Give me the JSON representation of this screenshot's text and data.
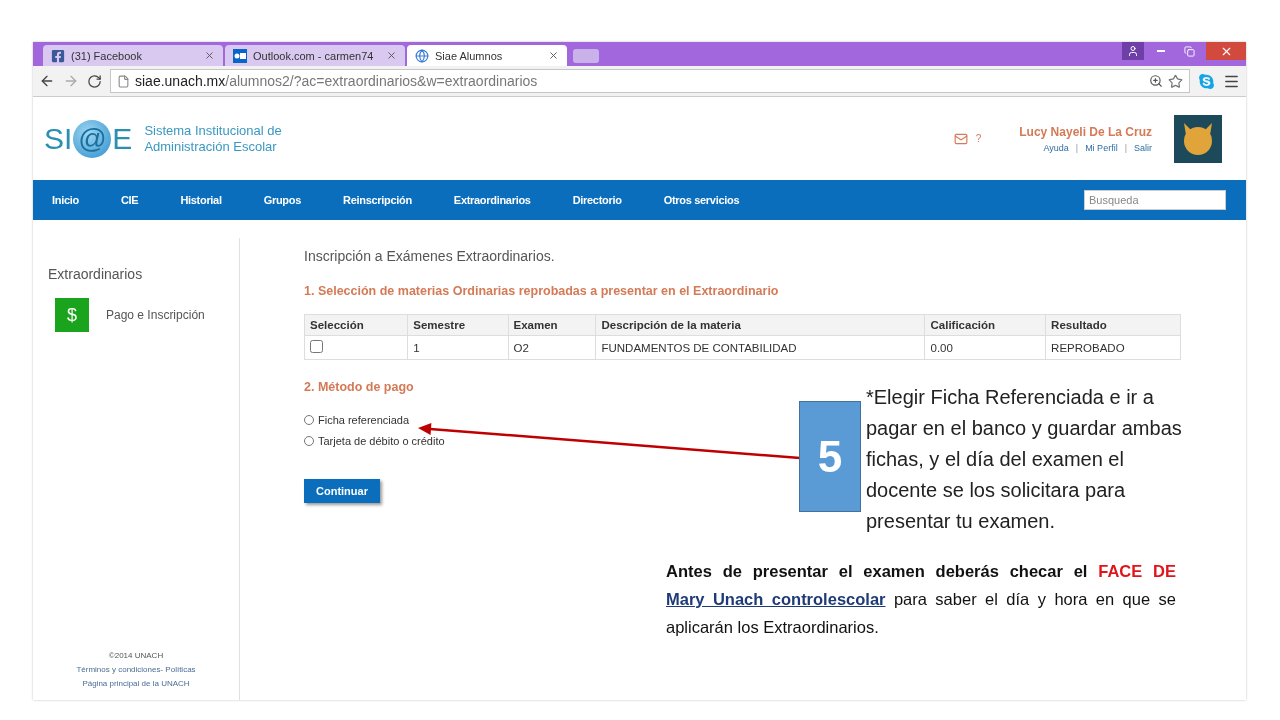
{
  "browser": {
    "tabs": [
      {
        "label": "(31) Facebook",
        "kind": "facebook",
        "selected": false
      },
      {
        "label": "Outlook.com - carmen74",
        "kind": "outlook",
        "selected": false
      },
      {
        "label": "Siae Alumnos",
        "kind": "globe",
        "selected": true
      }
    ],
    "url_host": "siae.unach.mx",
    "url_path": "/alumnos2/?ac=extraordinarios&w=extraordinarios"
  },
  "header": {
    "logo": {
      "left": "SI",
      "mark": "@",
      "right": "E"
    },
    "title_lines": [
      "Sistema Institucional de",
      "Administración Escolar"
    ],
    "help": "?",
    "user_name": "Lucy Nayeli De La Cruz",
    "user_links": [
      "Ayuda",
      "Mi Perfil",
      "Salir"
    ],
    "separator": "|"
  },
  "nav": {
    "items": [
      "Inicio",
      "CIE",
      "Historial",
      "Grupos",
      "Reinscripción",
      "Extraordinarios",
      "Directorio",
      "Otros servicios"
    ],
    "search": {
      "placeholder": "Busqueda"
    }
  },
  "sidebar": {
    "title": "Extraordinarios",
    "items": [
      {
        "icon": "$",
        "label": "Pago e Inscripción"
      }
    ]
  },
  "footer": {
    "copyright": "©2014 UNACH",
    "links": [
      "Términos y condiciones- Políticas",
      "Página principal de la UNACH"
    ]
  },
  "main": {
    "title": "Inscripción a Exámenes Extraordinarios.",
    "section_1": "1. Selección de materias Ordinarias reprobadas a presentar en el Extraordinario",
    "table": {
      "columns": [
        "Selección",
        "Semestre",
        "Examen",
        "Descripción de la materia",
        "Calificación",
        "Resultado"
      ],
      "rows": [
        {
          "cells": [
            {
              "kind": "checkbox",
              "checked": false
            },
            {
              "kind": "text",
              "text": "1"
            },
            {
              "kind": "text",
              "text": "O2"
            },
            {
              "kind": "text",
              "text": "FUNDAMENTOS DE CONTABILIDAD"
            },
            {
              "kind": "text",
              "text": "0.00"
            },
            {
              "kind": "text",
              "text": "REPROBADO"
            }
          ]
        }
      ]
    },
    "section_2": "2. Método de pago",
    "payment_options": [
      {
        "label": "Ficha referenciada",
        "selected": false
      },
      {
        "label": "Tarjeta de débito o crédito",
        "selected": false
      }
    ],
    "button": "Continuar"
  },
  "annotation": {
    "step": "5",
    "callout": "*Elegir Ficha Referenciada e ir a pagar en el banco y guardar ambas fichas, y el día del examen el docente se los solicitara para presentar tu examen.",
    "note": [
      {
        "kind": "bold",
        "text": "Antes de presentar el examen deberás checar el "
      },
      {
        "kind": "highlight",
        "text": "FACE DE "
      },
      {
        "kind": "link",
        "text": "Mary Unach controlescolar"
      },
      {
        "kind": "plain",
        "text": " para saber el día y hora en que se aplicarán los Extraordinarios."
      }
    ]
  }
}
